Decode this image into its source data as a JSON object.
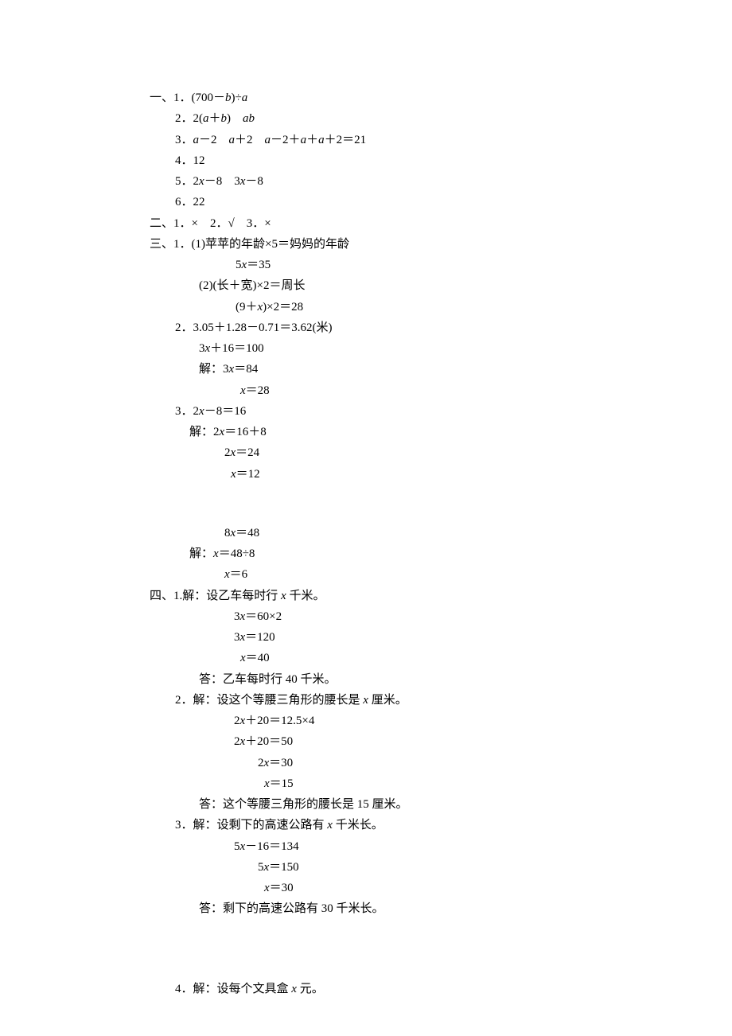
{
  "section1": {
    "label": "一、",
    "items": [
      {
        "num": "1．",
        "text": "(700－",
        "var1": "b",
        "text2": ")÷",
        "var2": "a"
      },
      {
        "num": "2．",
        "text": "2(",
        "var1": "a",
        "text2": "＋",
        "var2": "b",
        "text3": ")　",
        "var3": "ab"
      },
      {
        "num": "3．",
        "var1": "a",
        "text1": "－2　",
        "var2": "a",
        "text2": "＋2　",
        "var3": "a",
        "text3": "－2＋",
        "var4": "a",
        "text4": "＋",
        "var5": "a",
        "text5": "＋2＝21"
      },
      {
        "num": "4．",
        "text": "12"
      },
      {
        "num": "5．",
        "text": "2",
        "var1": "x",
        "text2": "－8　3",
        "var2": "x",
        "text3": "－8"
      },
      {
        "num": "6．",
        "text": "22"
      }
    ]
  },
  "section2": {
    "label": "二、",
    "text": "1．×　2．√　3．×"
  },
  "section3": {
    "label": "三、",
    "item1": {
      "num": "1．",
      "sub1": {
        "label": "(1)",
        "text": "苹苹的年龄×5＝妈妈的年龄"
      },
      "sub1_eq": {
        "text1": "5",
        "var": "x",
        "text2": "＝35"
      },
      "sub2": {
        "label": "(2)",
        "text": "(长＋宽)×2＝周长"
      },
      "sub2_eq": {
        "text1": "(9＋",
        "var": "x",
        "text2": ")×2＝28"
      }
    },
    "item2": {
      "num": "2．",
      "line1": "3.05＋1.28－0.71＝3.62(米)",
      "line2": {
        "text1": "3",
        "var": "x",
        "text2": "＋16＝100"
      },
      "line3": {
        "label": "解：",
        "text1": "3",
        "var": "x",
        "text2": "＝84"
      },
      "line4": {
        "var": "x",
        "text": "＝28"
      }
    },
    "item3": {
      "num": "3．",
      "line1": {
        "text1": "2",
        "var": "x",
        "text2": "－8＝16"
      },
      "line2": {
        "label": "解：",
        "text1": "2",
        "var": "x",
        "text2": "＝16＋8"
      },
      "line3": {
        "text1": "2",
        "var": "x",
        "text2": "＝24"
      },
      "line4": {
        "var": "x",
        "text": "＝12"
      },
      "line5": {
        "text1": "8",
        "var": "x",
        "text2": "＝48"
      },
      "line6": {
        "label": "解：",
        "var": "x",
        "text": "＝48÷8"
      },
      "line7": {
        "var": "x",
        "text": "＝6"
      }
    }
  },
  "section4": {
    "label": "四、",
    "item1": {
      "num": "1.",
      "setup": {
        "label": "解：",
        "text1": "设乙车每时行 ",
        "var": "x",
        "text2": " 千米。"
      },
      "eq1": {
        "text1": "3",
        "var": "x",
        "text2": "＝60×2"
      },
      "eq2": {
        "text1": "3",
        "var": "x",
        "text2": "＝120"
      },
      "eq3": {
        "var": "x",
        "text": "＝40"
      },
      "answer": {
        "label": "答：",
        "text": "乙车每时行 40 千米。"
      }
    },
    "item2": {
      "num": "2．",
      "setup": {
        "label": "解：",
        "text1": "设这个等腰三角形的腰长是 ",
        "var": "x",
        "text2": " 厘米。"
      },
      "eq1": {
        "text1": "2",
        "var": "x",
        "text2": "＋20＝12.5×4"
      },
      "eq2": {
        "text1": "2",
        "var": "x",
        "text2": "＋20＝50"
      },
      "eq3": {
        "text1": "2",
        "var": "x",
        "text2": "＝30"
      },
      "eq4": {
        "var": "x",
        "text": "＝15"
      },
      "answer": {
        "label": "答：",
        "text": "这个等腰三角形的腰长是 15 厘米。"
      }
    },
    "item3": {
      "num": "3．",
      "setup": {
        "label": "解：",
        "text1": "设剩下的高速公路有 ",
        "var": "x",
        "text2": " 千米长。"
      },
      "eq1": {
        "text1": "5",
        "var": "x",
        "text2": "－16＝134"
      },
      "eq2": {
        "text1": "5",
        "var": "x",
        "text2": "＝150"
      },
      "eq3": {
        "var": "x",
        "text": "＝30"
      },
      "answer": {
        "label": "答：",
        "text": "剩下的高速公路有 30 千米长。"
      }
    },
    "item4": {
      "num": "4．",
      "setup": {
        "label": "解：",
        "text1": "设每个文具盒 ",
        "var": "x",
        "text2": " 元。"
      }
    }
  }
}
